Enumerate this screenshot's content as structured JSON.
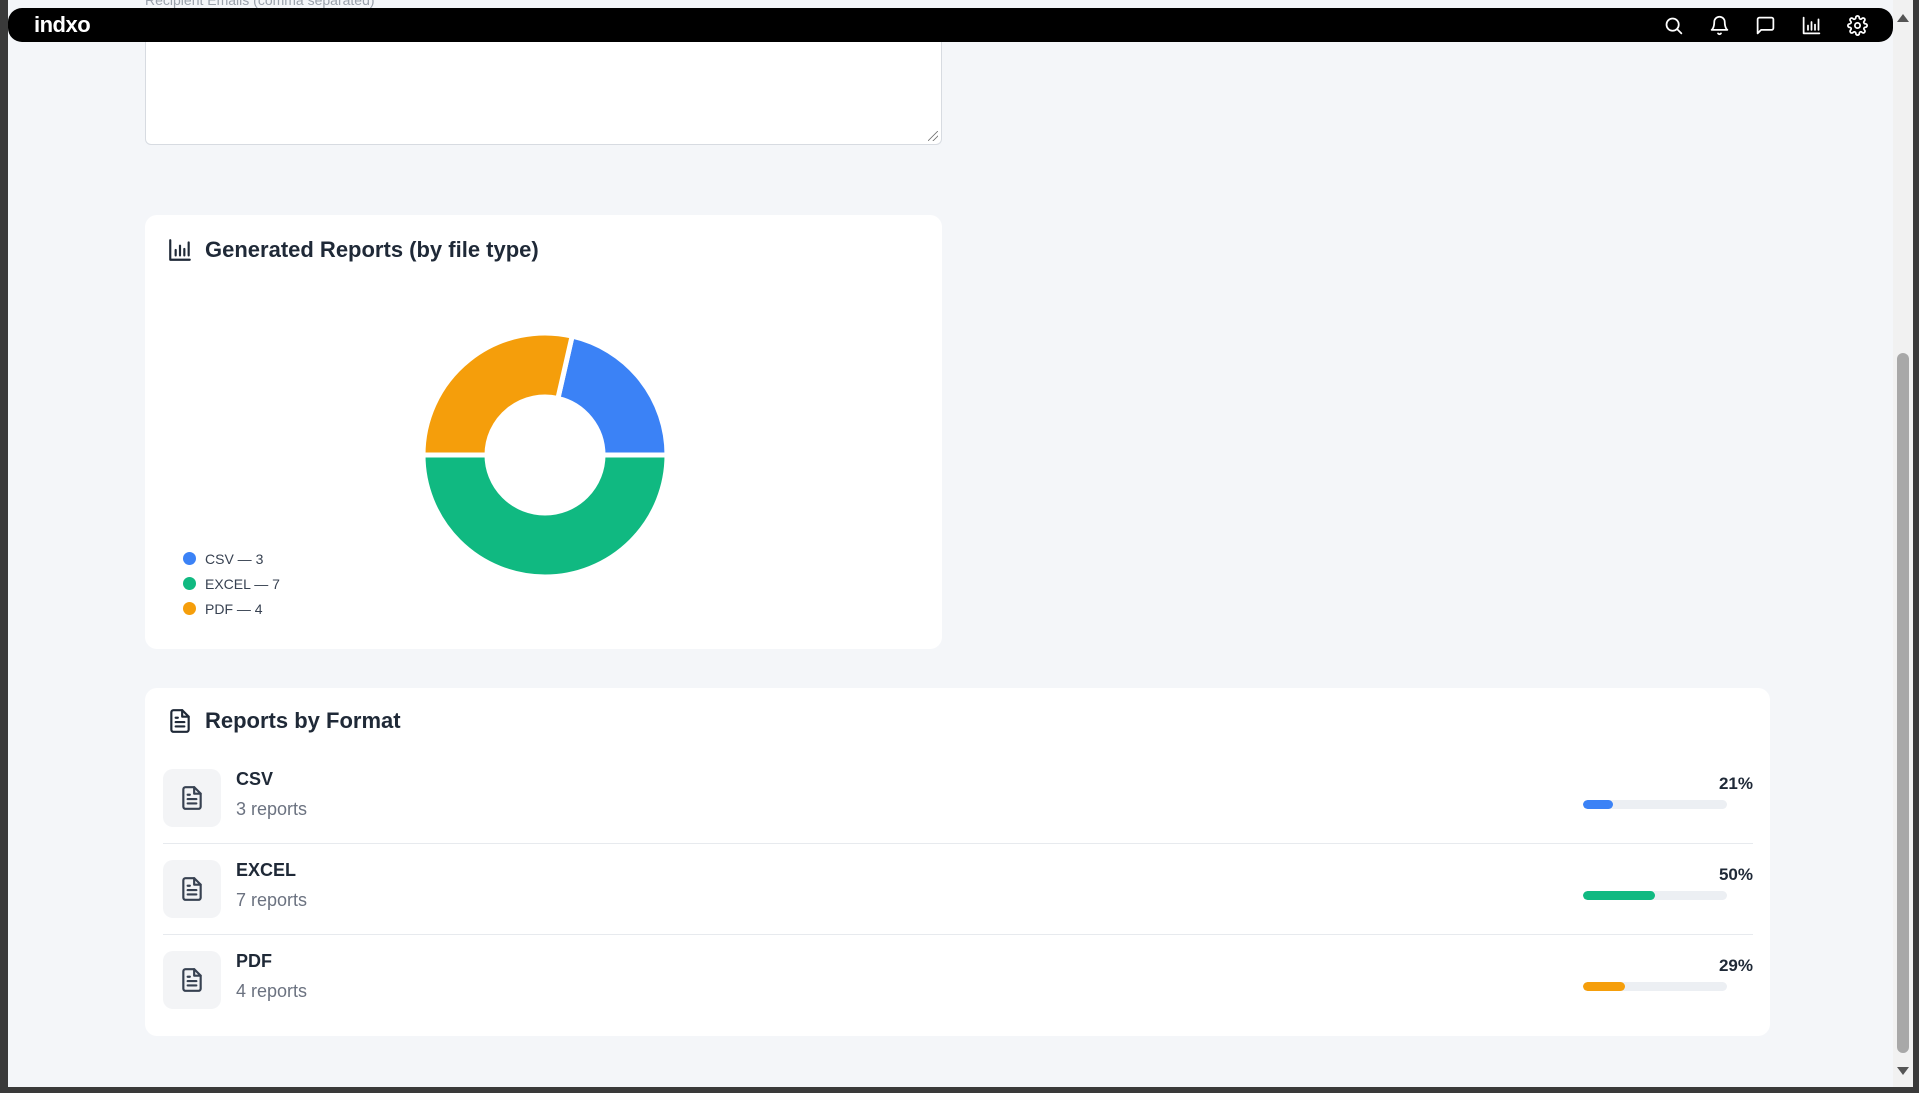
{
  "app": {
    "logo": "indxo"
  },
  "topbar": {
    "icons": [
      "search-icon",
      "bell-icon",
      "message-icon",
      "bar-chart-icon",
      "gear-icon"
    ]
  },
  "recipient": {
    "label": "Recipient Emails (comma separated)"
  },
  "chart_card": {
    "title": "Generated Reports (by file type)",
    "legend": [
      {
        "label": "CSV — 3",
        "color": "#3b82f6"
      },
      {
        "label": "EXCEL — 7",
        "color": "#10b981"
      },
      {
        "label": "PDF — 4",
        "color": "#f59e0b"
      }
    ]
  },
  "chart_data": {
    "type": "pie",
    "categories": [
      "CSV",
      "EXCEL",
      "PDF"
    ],
    "values": [
      3,
      7,
      4
    ],
    "colors": [
      "#3b82f6",
      "#10b981",
      "#f59e0b"
    ],
    "legend_position": "bottom-left"
  },
  "format_card": {
    "title": "Reports by Format",
    "rows": [
      {
        "name": "CSV",
        "count": "3 reports",
        "percent": "21%",
        "fill": 0.21,
        "color": "#3b82f6"
      },
      {
        "name": "EXCEL",
        "count": "7 reports",
        "percent": "50%",
        "fill": 0.5,
        "color": "#10b981"
      },
      {
        "name": "PDF",
        "count": "4 reports",
        "percent": "29%",
        "fill": 0.29,
        "color": "#f59e0b"
      }
    ]
  }
}
